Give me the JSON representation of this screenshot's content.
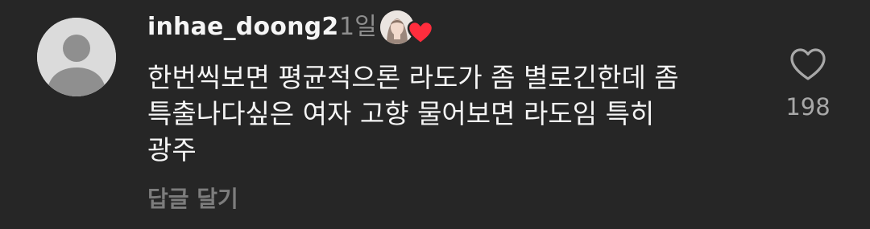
{
  "comment": {
    "username": "inhae_doong2",
    "timestamp": "1일",
    "text": "한번씩보면 평균적으론 라도가 좀 별로긴한데 좀\n특출나다싶은 여자 고향 물어보면 라도임 특히\n광주",
    "reply_label": "답글 달기",
    "like_count": "198"
  },
  "colors": {
    "background": "#262626",
    "text_primary": "#f5f5f5",
    "text_secondary": "#8e8e8e",
    "heart_badge": "#ff2d3d"
  },
  "icons": {
    "avatar": "default-avatar-icon",
    "creator_like": "heart-icon",
    "like": "heart-outline-icon"
  }
}
